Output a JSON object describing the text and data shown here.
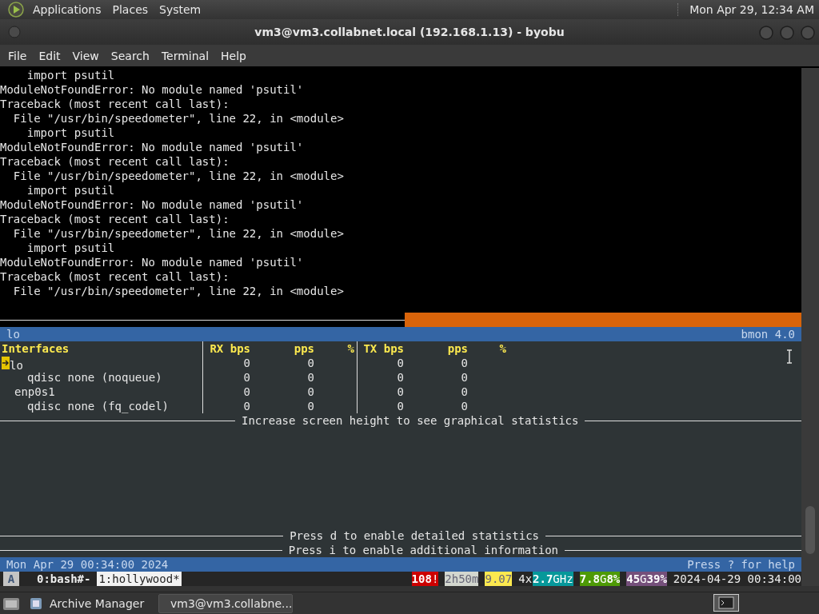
{
  "top_panel": {
    "menus": [
      "Applications",
      "Places",
      "System"
    ],
    "clock": "Mon Apr 29, 12:34 AM"
  },
  "window": {
    "title": "vm3@vm3.collabnet.local (192.168.1.13) - byobu",
    "menu": [
      "File",
      "Edit",
      "View",
      "Search",
      "Terminal",
      "Help"
    ]
  },
  "terminal": {
    "output_lines": [
      "    import psutil",
      "ModuleNotFoundError: No module named 'psutil'",
      "Traceback (most recent call last):",
      "  File \"/usr/bin/speedometer\", line 22, in <module>",
      "    import psutil",
      "ModuleNotFoundError: No module named 'psutil'",
      "Traceback (most recent call last):",
      "  File \"/usr/bin/speedometer\", line 22, in <module>",
      "    import psutil",
      "ModuleNotFoundError: No module named 'psutil'",
      "Traceback (most recent call last):",
      "  File \"/usr/bin/speedometer\", line 22, in <module>",
      "    import psutil",
      "ModuleNotFoundError: No module named 'psutil'",
      "Traceback (most recent call last):",
      "  File \"/usr/bin/speedometer\", line 22, in <module>"
    ]
  },
  "bmon": {
    "header": {
      "interface": "lo",
      "version": "bmon 4.0"
    },
    "columns": [
      "Interfaces",
      "RX bps",
      "pps",
      "%",
      "TX bps",
      "pps",
      "%"
    ],
    "interfaces": [
      {
        "name": "lo",
        "selected": true,
        "rx_bps": "0",
        "rx_pps": "0",
        "tx_bps": "0",
        "tx_pps": "0",
        "children": [
          {
            "name": "qdisc none (noqueue)",
            "selected": false,
            "rx_bps": "0",
            "rx_pps": "0",
            "tx_bps": "0",
            "tx_pps": "0"
          }
        ]
      },
      {
        "name": "enp0s1",
        "selected": false,
        "rx_bps": "0",
        "rx_pps": "0",
        "tx_bps": "0",
        "tx_pps": "0",
        "children": [
          {
            "name": "qdisc none (fq_codel)",
            "selected": false,
            "rx_bps": "0",
            "rx_pps": "0",
            "tx_bps": "0",
            "tx_pps": "0"
          }
        ]
      }
    ],
    "graph_notice": "Increase screen height to see graphical statistics",
    "hints": [
      "Press d to enable detailed statistics",
      "Press i to enable additional information"
    ],
    "footer": {
      "date": "Mon Apr 29 00:34:00 2024",
      "help": "Press ? for help"
    }
  },
  "byobu": {
    "logo": "A",
    "windows": [
      {
        "label": "0:bash#-",
        "selected": false
      },
      {
        "label": "1:hollywood*",
        "selected": true
      }
    ],
    "segments": [
      {
        "text": "**108**!",
        "color": "#cc0000"
      },
      {
        "text": "2h50m",
        "color": "#d3d7cf"
      },
      {
        "text": "9.07",
        "color": "#fce94f"
      },
      {
        "text": "4x"
      },
      {
        "text": "**2.7**GHz",
        "color": "#06989a"
      },
      {
        "text": "**7.8**G**8%**",
        "color": "#4e9a06"
      },
      {
        "text": "**45**G**39%**",
        "color": "#75507b"
      },
      {
        "text": "2024-04-29 00:34:00"
      }
    ]
  },
  "taskbar": {
    "items": [
      {
        "label": "Archive Manager",
        "selected": false
      },
      {
        "label": "vm3@vm3.collabne...",
        "selected": true
      }
    ]
  }
}
